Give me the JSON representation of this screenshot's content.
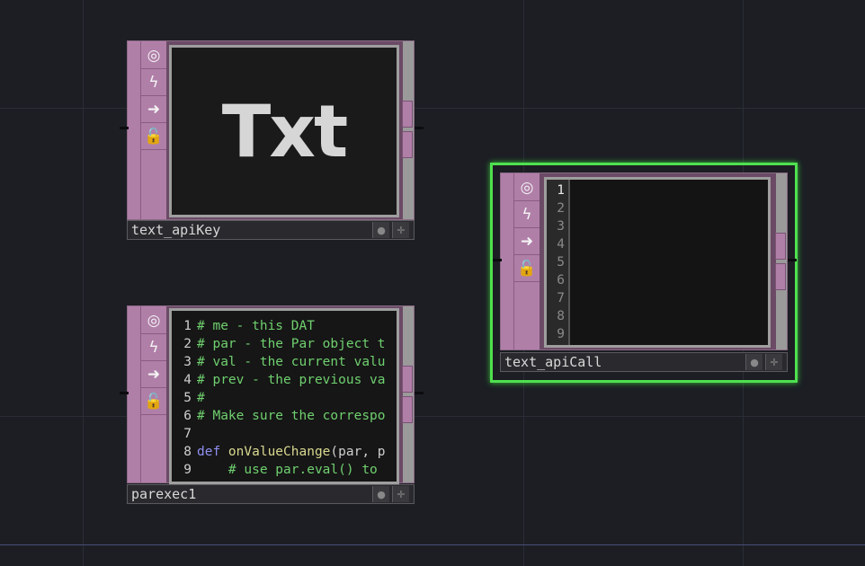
{
  "canvas": {
    "background": "#1c1e24",
    "selection_color": "#4fe04f",
    "dat_color": "#b07fa8"
  },
  "nodes": {
    "text_apiKey": {
      "name": "text_apiKey",
      "viewer_label": "Txt"
    },
    "parexec1": {
      "name": "parexec1",
      "code_lines": [
        {
          "num": "1",
          "text": "# me - this DAT"
        },
        {
          "num": "2",
          "text": "# par - the Par object t"
        },
        {
          "num": "3",
          "text": "# val - the current valu"
        },
        {
          "num": "4",
          "text": "# prev - the previous va"
        },
        {
          "num": "5",
          "text": "#"
        },
        {
          "num": "6",
          "text": "# Make sure the correspo"
        },
        {
          "num": "7",
          "text": ""
        },
        {
          "num": "8",
          "kw": "def ",
          "fn": "onValueChange",
          "text": "(par, p"
        },
        {
          "num": "9",
          "text": "    # use par.eval() to"
        }
      ]
    },
    "text_apiCall": {
      "name": "text_apiCall",
      "line_numbers": [
        "1",
        "2",
        "3",
        "4",
        "5",
        "6",
        "7",
        "8",
        "9"
      ]
    }
  },
  "side_buttons": {
    "viewer_icon": "circle-icon",
    "cook_icon": "lightning-icon",
    "bypass_icon": "arrow-right-icon",
    "lock_icon": "lock-icon"
  }
}
